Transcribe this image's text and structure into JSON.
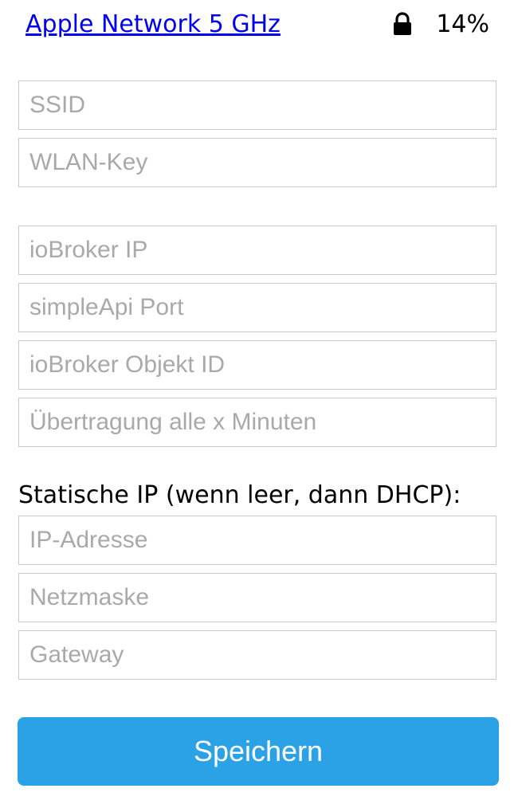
{
  "network": {
    "name": "Apple Network 5 GHz",
    "lock_icon": "lock-icon",
    "signal": "14%"
  },
  "wifi_fields": {
    "ssid_placeholder": "SSID",
    "ssid_value": "",
    "wlan_key_placeholder": "WLAN-Key",
    "wlan_key_value": ""
  },
  "iobroker_fields": {
    "ip_placeholder": "ioBroker IP",
    "ip_value": "",
    "port_placeholder": "simpleApi Port",
    "port_value": "",
    "object_id_placeholder": "ioBroker Objekt ID",
    "object_id_value": "",
    "interval_placeholder": "Übertragung alle x Minuten",
    "interval_value": ""
  },
  "static_ip": {
    "label": "Statische IP (wenn leer, dann DHCP):",
    "ip_placeholder": "IP-Adresse",
    "ip_value": "",
    "netmask_placeholder": "Netzmaske",
    "netmask_value": "",
    "gateway_placeholder": "Gateway",
    "gateway_value": ""
  },
  "actions": {
    "save_label": "Speichern"
  },
  "colors": {
    "link": "#0000ee",
    "button": "#2ba2e6",
    "button_text": "#ffffff",
    "field_border": "#c8c8c8",
    "placeholder": "#a9a9a9"
  }
}
